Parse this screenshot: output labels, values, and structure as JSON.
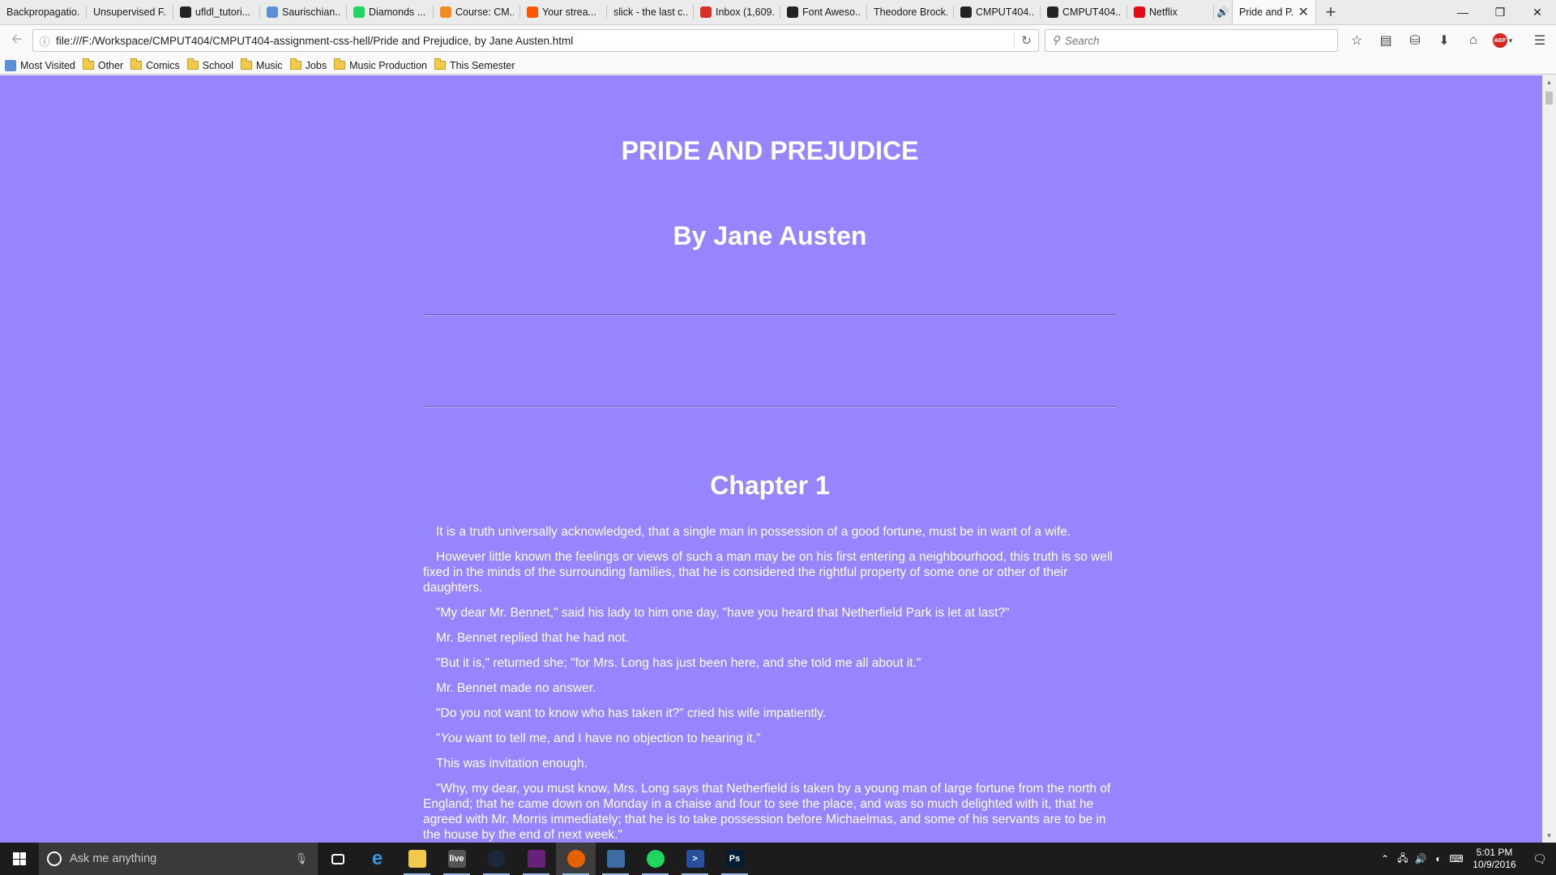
{
  "browser": {
    "tabs": [
      {
        "label": "Backpropagatio...",
        "icon": "none",
        "color": ""
      },
      {
        "label": "Unsupervised F...",
        "icon": "none",
        "color": ""
      },
      {
        "label": "ufldl_tutori...",
        "icon": "github-icon",
        "color": "#222222"
      },
      {
        "label": "Saurischian...",
        "icon": "link-icon",
        "color": "#5b8fd8"
      },
      {
        "label": "Diamonds ...",
        "icon": "spotify-icon",
        "color": "#1ed760"
      },
      {
        "label": "Course: CM...",
        "icon": "moodle-icon",
        "color": "#f18d1c"
      },
      {
        "label": "Your strea...",
        "icon": "soundcloud-icon",
        "color": "#ff5500"
      },
      {
        "label": "slick - the last c...",
        "icon": "none",
        "color": ""
      },
      {
        "label": "Inbox (1,609...",
        "icon": "gmail-icon",
        "color": "#d93025"
      },
      {
        "label": "Font Aweso...",
        "icon": "flag-icon",
        "color": "#222222"
      },
      {
        "label": "Theodore Brock...",
        "icon": "none",
        "color": ""
      },
      {
        "label": "CMPUT404...",
        "icon": "github-icon",
        "color": "#222222"
      },
      {
        "label": "CMPUT404...",
        "icon": "github-icon",
        "color": "#222222"
      },
      {
        "label": "Netflix",
        "icon": "netflix-icon",
        "color": "#e50914"
      }
    ],
    "active_tab": "Pride and P...",
    "url": "file:///F:/Workspace/CMPUT404/CMPUT404-assignment-css-hell/Pride and Prejudice, by Jane Austen.html",
    "search_placeholder": "Search",
    "bookmarks": [
      "Most Visited",
      "Other",
      "Comics",
      "School",
      "Music",
      "Jobs",
      "Music Production",
      "This Semester"
    ]
  },
  "page": {
    "background": "#9785ff",
    "title": "PRIDE AND PREJUDICE",
    "author": "By Jane Austen",
    "chapter": "Chapter 1",
    "paragraphs": [
      "It is a truth universally acknowledged, that a single man in possession of a good fortune, must be in want of a wife.",
      "However little known the feelings or views of such a man may be on his first entering a neighbourhood, this truth is so well fixed in the minds of the surrounding families, that he is considered the rightful property of some one or other of their daughters.",
      "\"My dear Mr. Bennet,\" said his lady to him one day, \"have you heard that Netherfield Park is let at last?\"",
      "Mr. Bennet replied that he had not.",
      "\"But it is,\" returned she; \"for Mrs. Long has just been here, and she told me all about it.\"",
      "Mr. Bennet made no answer.",
      "\"Do you not want to know who has taken it?\" cried his wife impatiently.",
      "\"You want to tell me, and I have no objection to hearing it.\"",
      "This was invitation enough.",
      "\"Why, my dear, you must know, Mrs. Long says that Netherfield is taken by a young man of large fortune from the north of England; that he came down on Monday in a chaise and four to see the place, and was so much delighted with it, that he agreed with Mr. Morris immediately; that he is to take possession before Michaelmas, and some of his servants are to be in the house by the end of next week.\""
    ]
  },
  "taskbar": {
    "search_placeholder": "Ask me anything",
    "clock_time": "5:01 PM",
    "clock_date": "10/9/2016",
    "apps": [
      {
        "name": "task-view-icon",
        "label": "",
        "color": "#1c1c1c"
      },
      {
        "name": "edge-icon",
        "label": "e",
        "color": "#1c1c1c"
      },
      {
        "name": "file-explorer-icon",
        "label": "",
        "color": "#f0c94d"
      },
      {
        "name": "live-icon",
        "label": "live",
        "color": "#555555"
      },
      {
        "name": "steam-icon",
        "label": "",
        "color": "#1b2838"
      },
      {
        "name": "visual-studio-icon",
        "label": "",
        "color": "#68217a"
      },
      {
        "name": "firefox-icon",
        "label": "",
        "color": "#e66000"
      },
      {
        "name": "network-app-icon",
        "label": "",
        "color": "#3a6ea5"
      },
      {
        "name": "spotify-icon",
        "label": "",
        "color": "#1ed760"
      },
      {
        "name": "powershell-icon",
        "label": ">",
        "color": "#2a4f9e"
      },
      {
        "name": "photoshop-icon",
        "label": "Ps",
        "color": "#001d34"
      }
    ]
  }
}
